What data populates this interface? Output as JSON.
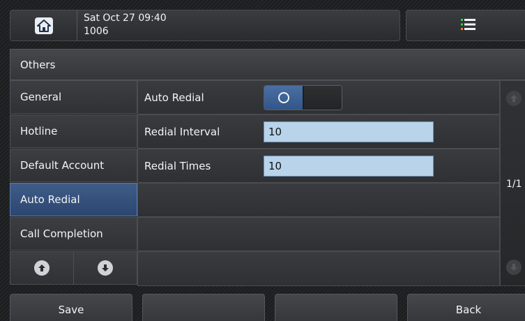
{
  "statusbar": {
    "date_time": "Sat Oct 27 09:40",
    "account": "1006"
  },
  "icons": {
    "home": "home-icon",
    "menu": "menu-list-icon",
    "scroll_up": "arrow-up-circle-icon",
    "scroll_down": "arrow-down-circle-icon"
  },
  "panel": {
    "title": "Others"
  },
  "sidebar": {
    "items": [
      {
        "label": "General"
      },
      {
        "label": "Hotline"
      },
      {
        "label": "Default Account"
      },
      {
        "label": "Auto Redial",
        "active": true
      },
      {
        "label": "Call Completion"
      }
    ]
  },
  "settings": {
    "auto_redial": {
      "label": "Auto Redial",
      "enabled": true
    },
    "redial_interval": {
      "label": "Redial Interval",
      "value": "10"
    },
    "redial_times": {
      "label": "Redial Times",
      "value": "10"
    }
  },
  "pager": {
    "text": "1/1"
  },
  "softkeys": {
    "save": "Save",
    "key2": "",
    "key3": "",
    "back": "Back"
  },
  "colors": {
    "accent": "#3f5d88",
    "field_bg": "#b8d3ea",
    "menu_icon_green": "#37d05a",
    "menu_icon_orange": "#ff7a2a"
  }
}
